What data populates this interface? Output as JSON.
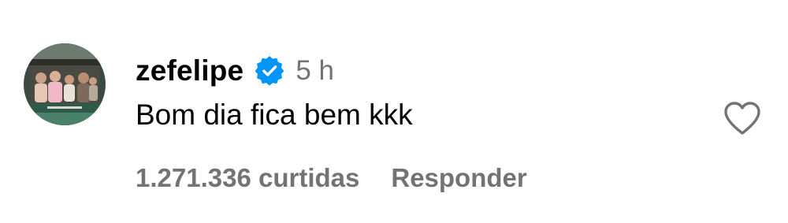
{
  "comment": {
    "username": "zefelipe",
    "verified_icon": "verified-badge-icon",
    "time": "5 h",
    "text": "Bom dia fica bem kkk",
    "likes": "1.271.336 curtidas",
    "reply_label": "Responder",
    "like_icon": "heart-outline-icon"
  },
  "colors": {
    "verified_blue": "#0095F6",
    "secondary_text": "#737373",
    "primary_text": "#000000",
    "heart_outline": "#737373"
  }
}
